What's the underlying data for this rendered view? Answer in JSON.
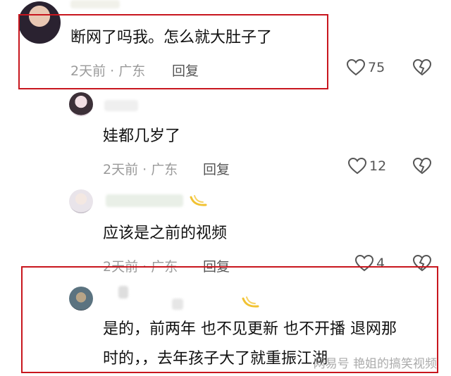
{
  "main_comment": {
    "text": "断网了吗我。怎么就大肚子了",
    "time": "2天前 · 广东",
    "reply_label": "回复",
    "likes": "75"
  },
  "replies": [
    {
      "text": "娃都几岁了",
      "time": "2天前 · 广东",
      "reply_label": "回复",
      "likes": "12"
    },
    {
      "text": "应该是之前的视频",
      "time": "2天前 · 广东",
      "reply_label": "回复",
      "likes": "4"
    },
    {
      "text_line1": "是的，前两年 也不见更新 也不开播 退网那",
      "text_line2": "时的，，去年孩子大了就重振江湖"
    }
  ],
  "watermark": "网易号 艳姐的搞笑视频",
  "colors": {
    "highlight": "#c8161e",
    "meta_text": "#9a9a9a",
    "icon": "#555555"
  },
  "icons": [
    "heart-outline-icon",
    "broken-heart-icon",
    "vip-badge-icon"
  ]
}
